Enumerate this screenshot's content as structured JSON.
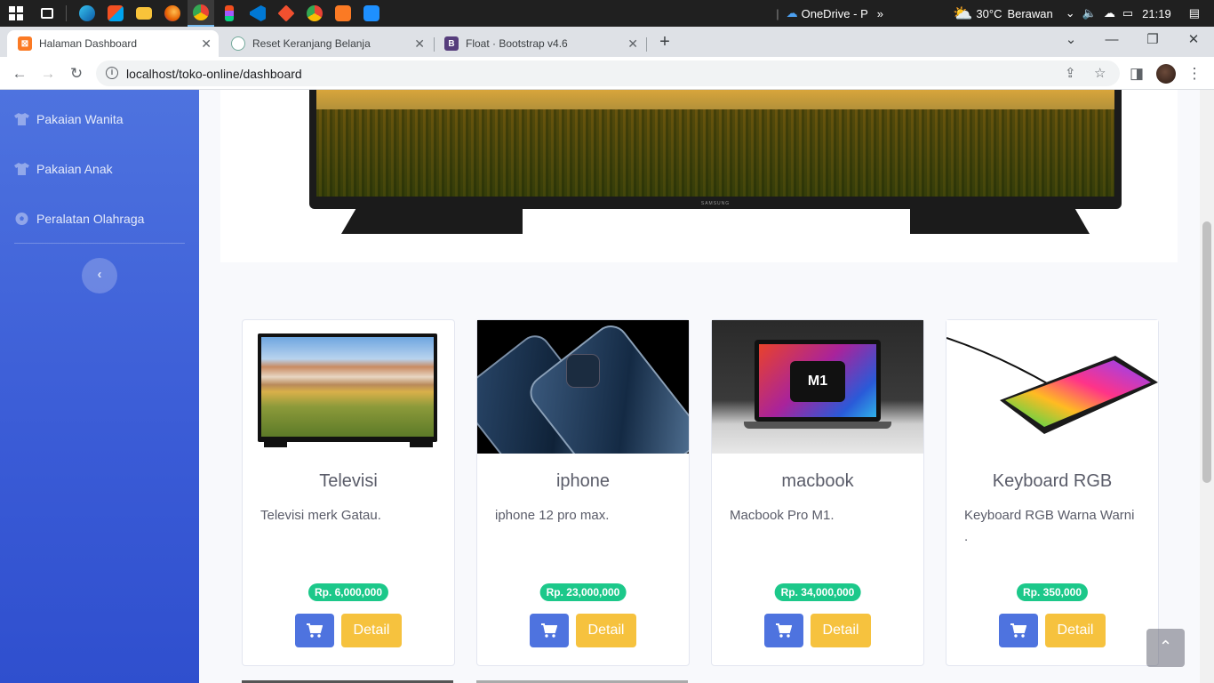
{
  "taskbar": {
    "onedrive": "OneDrive - P",
    "weather_temp": "30°C",
    "weather_text": "Berawan",
    "time": "21:19"
  },
  "browser": {
    "tabs": [
      {
        "label": "Halaman Dashboard",
        "active": true
      },
      {
        "label": "Reset Keranjang Belanja",
        "active": false
      },
      {
        "label": "Float · Bootstrap v4.6",
        "active": false
      }
    ],
    "url": "localhost/toko-online/dashboard"
  },
  "sidebar": {
    "items": [
      {
        "label": "Pakaian Wanita",
        "icon": "tshirt-icon"
      },
      {
        "label": "Pakaian Anak",
        "icon": "tshirt-icon"
      },
      {
        "label": "Peralatan Olahraga",
        "icon": "futbol-icon"
      }
    ],
    "toggle_icon": "‹"
  },
  "products": [
    {
      "name": "Televisi",
      "desc": "Televisi merk Gatau.",
      "price": "Rp. 6,000,000",
      "detail_label": "Detail"
    },
    {
      "name": "iphone",
      "desc": "iphone 12 pro max.",
      "price": "Rp. 23,000,000",
      "detail_label": "Detail"
    },
    {
      "name": "macbook",
      "desc": "Macbook Pro M1.",
      "price": "Rp. 34,000,000",
      "detail_label": "Detail"
    },
    {
      "name": "Keyboard RGB",
      "desc": "Keyboard RGB Warna Warni .",
      "price": "Rp. 350,000",
      "detail_label": "Detail"
    }
  ],
  "macbook_screen_text": "M1",
  "colors": {
    "primary": "#4e73df",
    "success": "#1cc88a",
    "warning": "#f6c23e",
    "text": "#5a5c69"
  }
}
